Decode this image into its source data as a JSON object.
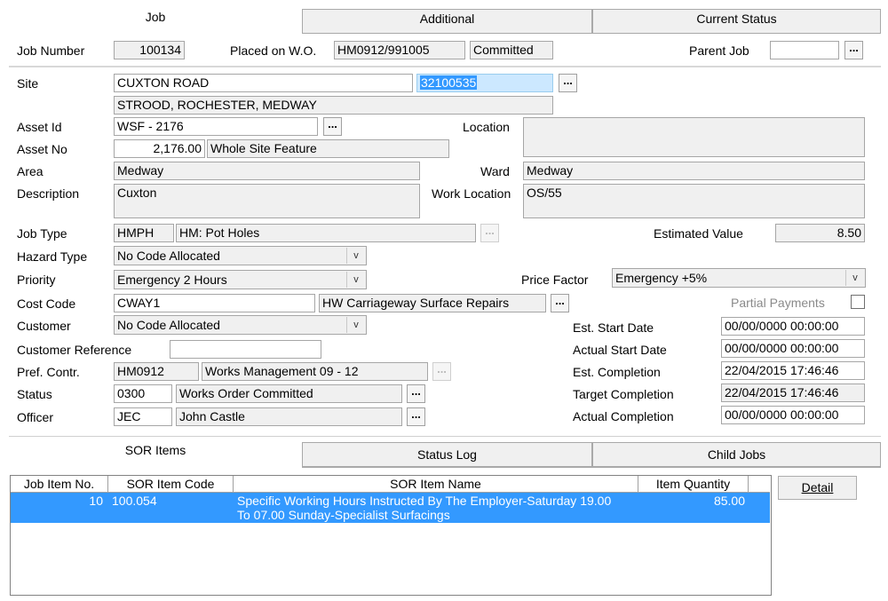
{
  "top_tabs": [
    {
      "label": "Job"
    },
    {
      "label": "Additional"
    },
    {
      "label": "Current Status"
    }
  ],
  "header": {
    "job_number_label": "Job Number",
    "job_number": "100134",
    "placed_on_label": "Placed on W.O.",
    "placed_on": "HM0912/991005",
    "wo_status": "Committed",
    "parent_job_label": "Parent Job",
    "parent_job": ""
  },
  "site": {
    "label": "Site",
    "name": "CUXTON ROAD",
    "code": "32100535",
    "address": "STROOD, ROCHESTER, MEDWAY"
  },
  "asset": {
    "id_label": "Asset Id",
    "id": "WSF - 2176",
    "no_label": "Asset No",
    "no": "2,176.00",
    "no_desc": "Whole Site Feature",
    "location_label": "Location",
    "location": ""
  },
  "area": {
    "label": "Area",
    "value": "Medway"
  },
  "ward": {
    "label": "Ward",
    "value": "Medway"
  },
  "description": {
    "label": "Description",
    "value": "Cuxton"
  },
  "work_location": {
    "label": "Work Location",
    "value": "OS/55"
  },
  "job_type": {
    "label": "Job Type",
    "code": "HMPH",
    "desc": "HM: Pot Holes"
  },
  "estimated_value": {
    "label": "Estimated Value",
    "value": "8.50"
  },
  "hazard_type": {
    "label": "Hazard Type",
    "value": "No Code Allocated"
  },
  "priority": {
    "label": "Priority",
    "value": "Emergency 2 Hours"
  },
  "price_factor": {
    "label": "Price Factor",
    "value": "Emergency +5%"
  },
  "cost_code": {
    "label": "Cost Code",
    "code": "CWAY1",
    "desc": "HW Carriageway Surface Repairs"
  },
  "partial_payments": {
    "label": "Partial Payments"
  },
  "customer": {
    "label": "Customer",
    "value": "No Code Allocated"
  },
  "customer_reference": {
    "label": "Customer Reference",
    "value": ""
  },
  "pref_contr": {
    "label": "Pref. Contr.",
    "code": "HM0912",
    "desc": "Works Management 09 - 12"
  },
  "status": {
    "label": "Status",
    "code": "0300",
    "desc": "Works Order Committed"
  },
  "officer": {
    "label": "Officer",
    "code": "JEC",
    "desc": "John Castle"
  },
  "dates": {
    "est_start_label": "Est. Start Date",
    "est_start": "00/00/0000 00:00:00",
    "actual_start_label": "Actual Start Date",
    "actual_start": "00/00/0000 00:00:00",
    "est_completion_label": "Est. Completion",
    "est_completion": "22/04/2015 17:46:46",
    "target_completion_label": "Target Completion",
    "target_completion": "22/04/2015 17:46:46",
    "actual_completion_label": "Actual Completion",
    "actual_completion": "00/00/0000 00:00:00"
  },
  "bottom_tabs": [
    {
      "label": "SOR Items"
    },
    {
      "label": "Status Log"
    },
    {
      "label": "Child Jobs"
    }
  ],
  "sor_table": {
    "columns": [
      "Job Item No.",
      "SOR Item Code",
      "SOR Item Name",
      "Item Quantity"
    ],
    "rows": [
      {
        "item_no": "10",
        "code": "100.054",
        "name_line1": "Specific Working Hours Instructed By The Employer-Saturday 19.00",
        "name_line2": "To 07.00 Sunday-Specialist Surfacings",
        "quantity": "85.00"
      }
    ]
  },
  "detail_button": "Detail",
  "ellipsis": "...",
  "dropdown_glyph": "v"
}
